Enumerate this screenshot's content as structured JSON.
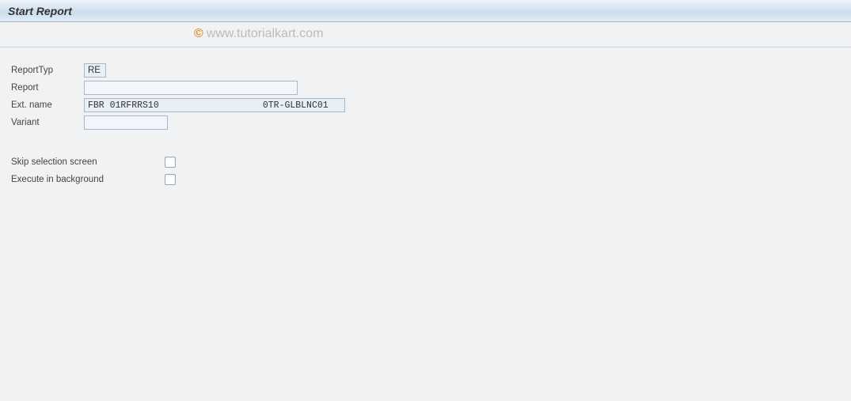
{
  "header": {
    "title": "Start Report"
  },
  "watermark": {
    "symbol": "©",
    "text": "www.tutorialkart.com"
  },
  "form": {
    "report_type": {
      "label": "ReportTyp",
      "value": "RE"
    },
    "report": {
      "label": "Report",
      "value": ""
    },
    "ext_name": {
      "label": "Ext. name",
      "value": "FBR 01RFRRS10                   0TR-GLBLNC01"
    },
    "variant": {
      "label": "Variant",
      "value": ""
    }
  },
  "checks": {
    "skip_selection": {
      "label": "Skip selection screen",
      "checked": false
    },
    "execute_bg": {
      "label": "Execute in background",
      "checked": false
    }
  }
}
